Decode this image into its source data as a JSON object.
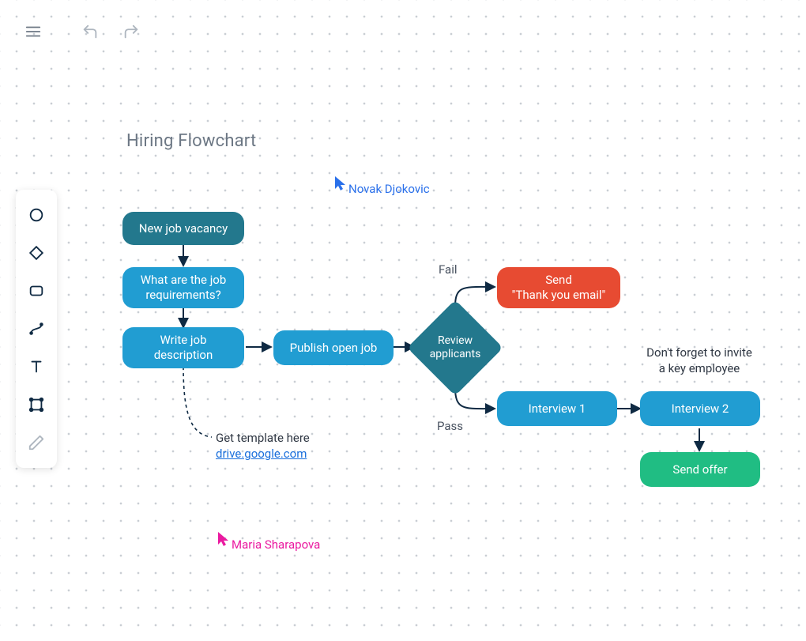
{
  "title": "Hiring Flowchart",
  "cursors": {
    "novak": "Novak Djokovic",
    "maria": "Maria Sharapova"
  },
  "nodes": {
    "new_job_vacancy": "New job vacancy",
    "requirements": "What are the job requirements?",
    "write_desc": "Write job description",
    "publish": "Publish open job",
    "review": "Review applicants",
    "fail_label": "Fail",
    "pass_label": "Pass",
    "send_thanks": "Send\n\"Thank you email\"",
    "interview1": "Interview 1",
    "interview2": "Interview 2",
    "send_offer": "Send offer",
    "invite_note": "Don't forget to invite\na key employee",
    "template_note": "Get template here",
    "template_link": "drive.google.com"
  }
}
